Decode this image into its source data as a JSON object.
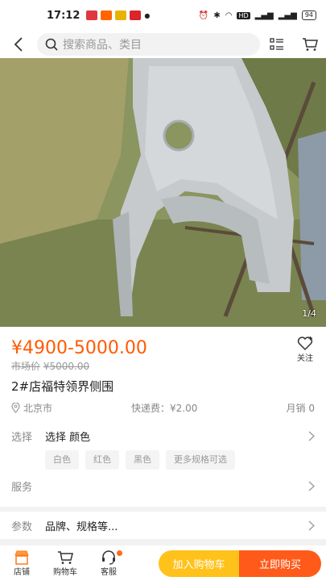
{
  "status_bar": {
    "time": "17:12",
    "network": "HD",
    "battery": "94"
  },
  "nav": {
    "search_placeholder": "搜索商品、类目"
  },
  "gallery": {
    "page_indicator": "1/4"
  },
  "product": {
    "price": "¥4900-5000.00",
    "market_price_label": "市场价",
    "market_price": "¥5000.00",
    "follow_label": "关注",
    "title": "2#店福特领界侧围",
    "location": "北京市",
    "shipping": "快递费：¥2.00",
    "sales": "月销 0"
  },
  "options": {
    "select_label": "选择",
    "select_value": "选择 颜色",
    "chips": [
      "白色",
      "红色",
      "黑色",
      "更多规格可选"
    ],
    "service_label": "服务"
  },
  "params": {
    "label": "参数",
    "value": "品牌、规格等..."
  },
  "bottom_bar": {
    "shop_label": "店铺",
    "cart_label": "购物车",
    "service_label": "客服",
    "add_to_cart": "加入购物车",
    "buy_now": "立即购买"
  },
  "colors": {
    "accent": "#ff5a00",
    "cart_button": "#ffc21a",
    "buy_button": "#ff5a1a"
  }
}
